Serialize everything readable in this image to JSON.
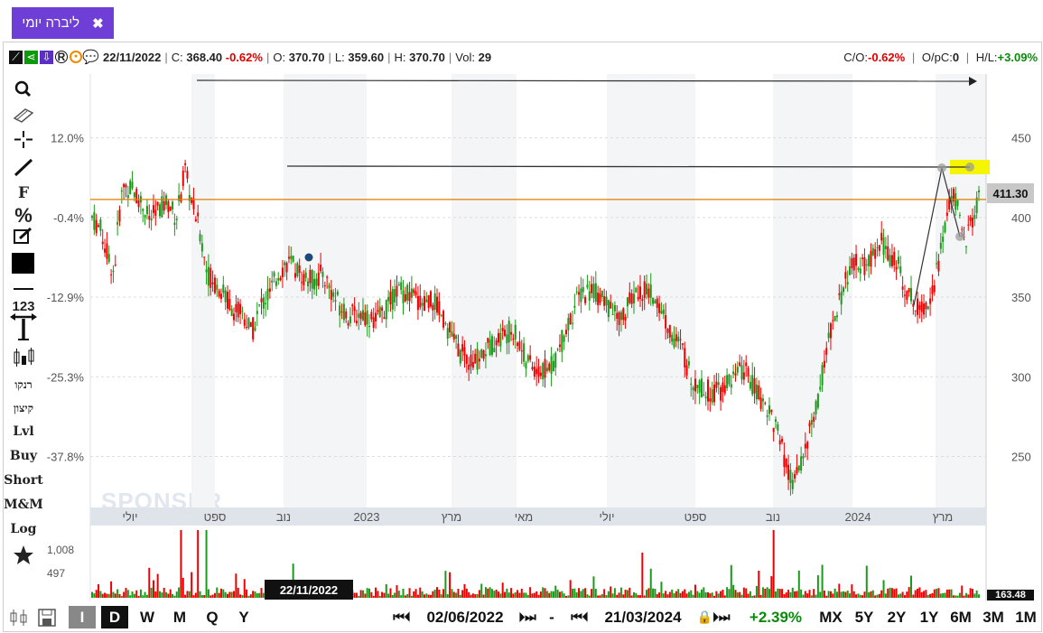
{
  "tab": {
    "title": "ליברה יומי",
    "close": "✖"
  },
  "info": {
    "icons": [
      "chart-tool-icon",
      "share-icon",
      "download-icon",
      "registered-icon",
      "target-icon",
      "comment-icon"
    ],
    "date": "22/11/2022",
    "c_label": "C:",
    "close": "368.40",
    "change": "-0.62%",
    "o_label": "O:",
    "open": "370.70",
    "l_label": "L:",
    "low": "359.60",
    "h_label": "H:",
    "high": "370.70",
    "vol_label": "Vol:",
    "vol": "29",
    "co_label": "C/O:",
    "co": "-0.62%",
    "opc_label": "O/pC:",
    "opc": "0",
    "hl_label": "H/L:",
    "hl": "+3.09%"
  },
  "toolbar": {
    "f": "F",
    "pct": "%",
    "num": "123",
    "revach": "רנקו",
    "kitzun": "קיצון",
    "lvl": "Lvl",
    "buy": "Buy",
    "short": "Short",
    "mm": "M&M",
    "log": "Log"
  },
  "bottom": {
    "I": "I",
    "D": "D",
    "W": "W",
    "M": "M",
    "Q": "Q",
    "Y": "Y",
    "start_date": "02/06/2022",
    "dash": "-",
    "end_date": "21/03/2024",
    "change": "+2.39%",
    "ranges": [
      "MX",
      "5Y",
      "2Y",
      "1Y",
      "6M",
      "3M",
      "1M"
    ]
  },
  "tags": {
    "price": "411.30",
    "volume": "163.48",
    "date": "22/11/2022"
  },
  "watermark": "SPONSER",
  "colors": {
    "up": "#1a9a1a",
    "down": "#ee0000",
    "accent": "#6f3ed6",
    "level": "#e07b00",
    "highlight": "#f5f500"
  },
  "chart_data": {
    "type": "candlestick",
    "left_axis_ticks": [
      "12.0%",
      "-0.4%",
      "-12.9%",
      "-25.3%",
      "-37.8%"
    ],
    "right_axis_ticks": [
      450,
      400,
      350,
      300,
      250
    ],
    "ylim": [
      218,
      490
    ],
    "x_labels": [
      "יולי",
      "ספט",
      "נוב",
      "2023",
      "מרץ",
      "מאי",
      "יולי",
      "ספט",
      "נוב",
      "2024",
      "מרץ"
    ],
    "x_range": [
      "2022-06",
      "2024-03"
    ],
    "price_path": [
      [
        0,
        400
      ],
      [
        0.01,
        392
      ],
      [
        0.018,
        375
      ],
      [
        0.025,
        365
      ],
      [
        0.03,
        400
      ],
      [
        0.035,
        420
      ],
      [
        0.045,
        418
      ],
      [
        0.055,
        410
      ],
      [
        0.065,
        398
      ],
      [
        0.075,
        405
      ],
      [
        0.085,
        410
      ],
      [
        0.095,
        400
      ],
      [
        0.105,
        430
      ],
      [
        0.11,
        415
      ],
      [
        0.12,
        395
      ],
      [
        0.13,
        365
      ],
      [
        0.145,
        355
      ],
      [
        0.16,
        342
      ],
      [
        0.17,
        340
      ],
      [
        0.18,
        328
      ],
      [
        0.19,
        345
      ],
      [
        0.2,
        352
      ],
      [
        0.21,
        365
      ],
      [
        0.22,
        372
      ],
      [
        0.23,
        368
      ],
      [
        0.24,
        362
      ],
      [
        0.25,
        360
      ],
      [
        0.26,
        365
      ],
      [
        0.275,
        348
      ],
      [
        0.29,
        338
      ],
      [
        0.305,
        340
      ],
      [
        0.32,
        335
      ],
      [
        0.335,
        345
      ],
      [
        0.345,
        355
      ],
      [
        0.36,
        350
      ],
      [
        0.375,
        345
      ],
      [
        0.385,
        348
      ],
      [
        0.4,
        332
      ],
      [
        0.415,
        315
      ],
      [
        0.43,
        308
      ],
      [
        0.445,
        318
      ],
      [
        0.46,
        325
      ],
      [
        0.475,
        330
      ],
      [
        0.49,
        310
      ],
      [
        0.505,
        302
      ],
      [
        0.52,
        308
      ],
      [
        0.535,
        330
      ],
      [
        0.55,
        352
      ],
      [
        0.565,
        355
      ],
      [
        0.58,
        345
      ],
      [
        0.595,
        335
      ],
      [
        0.61,
        350
      ],
      [
        0.625,
        355
      ],
      [
        0.64,
        345
      ],
      [
        0.655,
        325
      ],
      [
        0.665,
        318
      ],
      [
        0.675,
        300
      ],
      [
        0.69,
        292
      ],
      [
        0.705,
        290
      ],
      [
        0.72,
        298
      ],
      [
        0.735,
        305
      ],
      [
        0.75,
        290
      ],
      [
        0.765,
        278
      ],
      [
        0.775,
        262
      ],
      [
        0.785,
        238
      ],
      [
        0.792,
        232
      ],
      [
        0.8,
        248
      ],
      [
        0.81,
        268
      ],
      [
        0.818,
        282
      ],
      [
        0.826,
        310
      ],
      [
        0.834,
        330
      ],
      [
        0.842,
        345
      ],
      [
        0.85,
        360
      ],
      [
        0.86,
        372
      ],
      [
        0.87,
        368
      ],
      [
        0.88,
        375
      ],
      [
        0.89,
        385
      ],
      [
        0.9,
        375
      ],
      [
        0.91,
        368
      ],
      [
        0.92,
        352
      ],
      [
        0.93,
        345
      ],
      [
        0.94,
        345
      ],
      [
        0.95,
        360
      ],
      [
        0.96,
        388
      ],
      [
        0.97,
        418
      ],
      [
        0.978,
        400
      ],
      [
        0.985,
        385
      ],
      [
        0.992,
        398
      ],
      [
        1,
        411.3
      ]
    ],
    "current_price": 411.3,
    "annotations": [
      "horizontal-level",
      "resistance-line",
      "arrow-line",
      "trend-triangle"
    ]
  }
}
